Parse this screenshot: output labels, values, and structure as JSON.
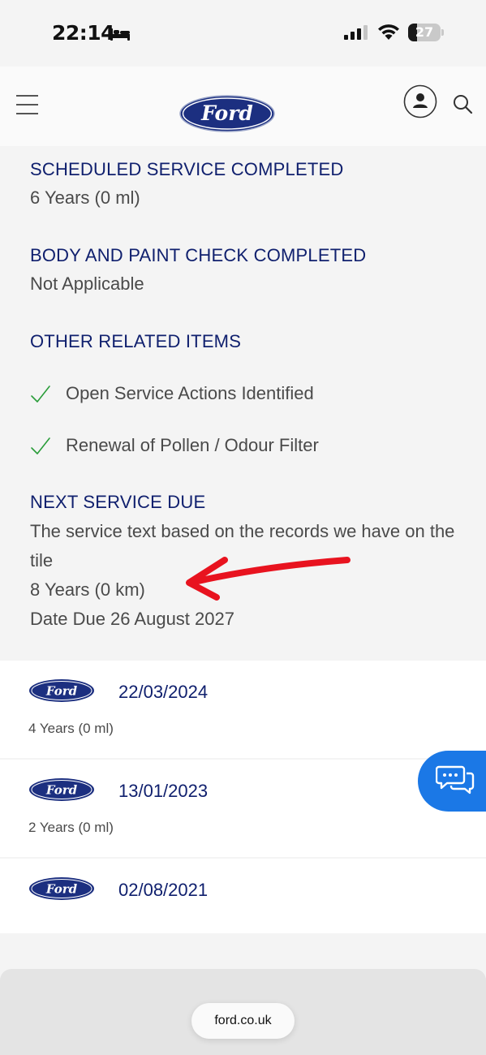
{
  "status_bar": {
    "time": "22:14",
    "battery_level": "27",
    "battery_fraction": 0.27,
    "icons": [
      "bed-icon",
      "cellular-signal-icon",
      "wifi-icon",
      "battery-icon"
    ]
  },
  "header": {
    "brand": "Ford",
    "icons": [
      "hamburger-menu-icon",
      "ford-logo",
      "account-icon",
      "search-icon"
    ]
  },
  "details": {
    "scheduled_service": {
      "heading": "SCHEDULED SERVICE COMPLETED",
      "value": "6 Years (0 ml)"
    },
    "body_paint": {
      "heading": "BODY AND PAINT CHECK COMPLETED",
      "value": "Not Applicable"
    },
    "other_items": {
      "heading": "OTHER RELATED ITEMS",
      "items": [
        {
          "label": "Open Service Actions Identified",
          "icon": "checkmark-icon"
        },
        {
          "label": "Renewal of Pollen / Odour Filter",
          "icon": "checkmark-icon"
        }
      ]
    },
    "next_service": {
      "heading": "NEXT SERVICE DUE",
      "line1": "The service text based on the records we have on the tile",
      "line2": "8 Years (0 km)",
      "line3": "Date Due 26 August 2027"
    },
    "annotation_color": "#e8131f"
  },
  "history": [
    {
      "date": "22/03/2024",
      "detail": "4 Years (0 ml)"
    },
    {
      "date": "13/01/2023",
      "detail": "2 Years (0 ml)"
    },
    {
      "date": "02/08/2021",
      "detail": ""
    }
  ],
  "chat": {
    "icon": "chat-bubbles-icon",
    "color": "#1b78e6"
  },
  "browser": {
    "url": "ford.co.uk"
  },
  "colors": {
    "ford_blue": "#10206e",
    "logo_blue": "#1c2f80",
    "text_gray": "#4a4a4a",
    "check_green": "#2a9d3a"
  }
}
